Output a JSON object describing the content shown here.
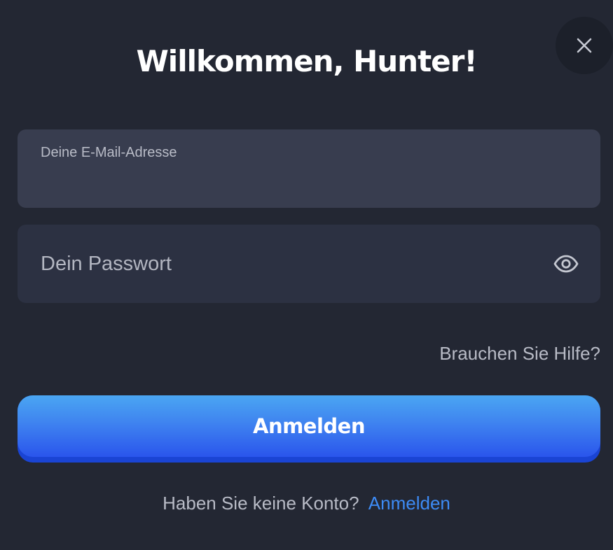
{
  "dialog": {
    "title": "Willkommen, Hunter!",
    "close_icon": "close-icon"
  },
  "email_field": {
    "label": "Deine E-Mail-Adresse",
    "value": ""
  },
  "password_field": {
    "placeholder": "Dein Passwort",
    "value": "",
    "toggle_icon": "eye-icon"
  },
  "help_link": "Brauchen Sie Hilfe?",
  "submit_button": {
    "label": "Anmelden"
  },
  "footer": {
    "prompt": "Haben Sie keine Konto?",
    "link_label": "Anmelden"
  },
  "colors": {
    "background": "#232733",
    "email_field_bg": "#383d4f",
    "password_field_bg": "#2c3142",
    "button_gradient_top": "#4aa6f2",
    "button_gradient_bottom": "#2a55ec",
    "link": "#3d8bf5"
  }
}
